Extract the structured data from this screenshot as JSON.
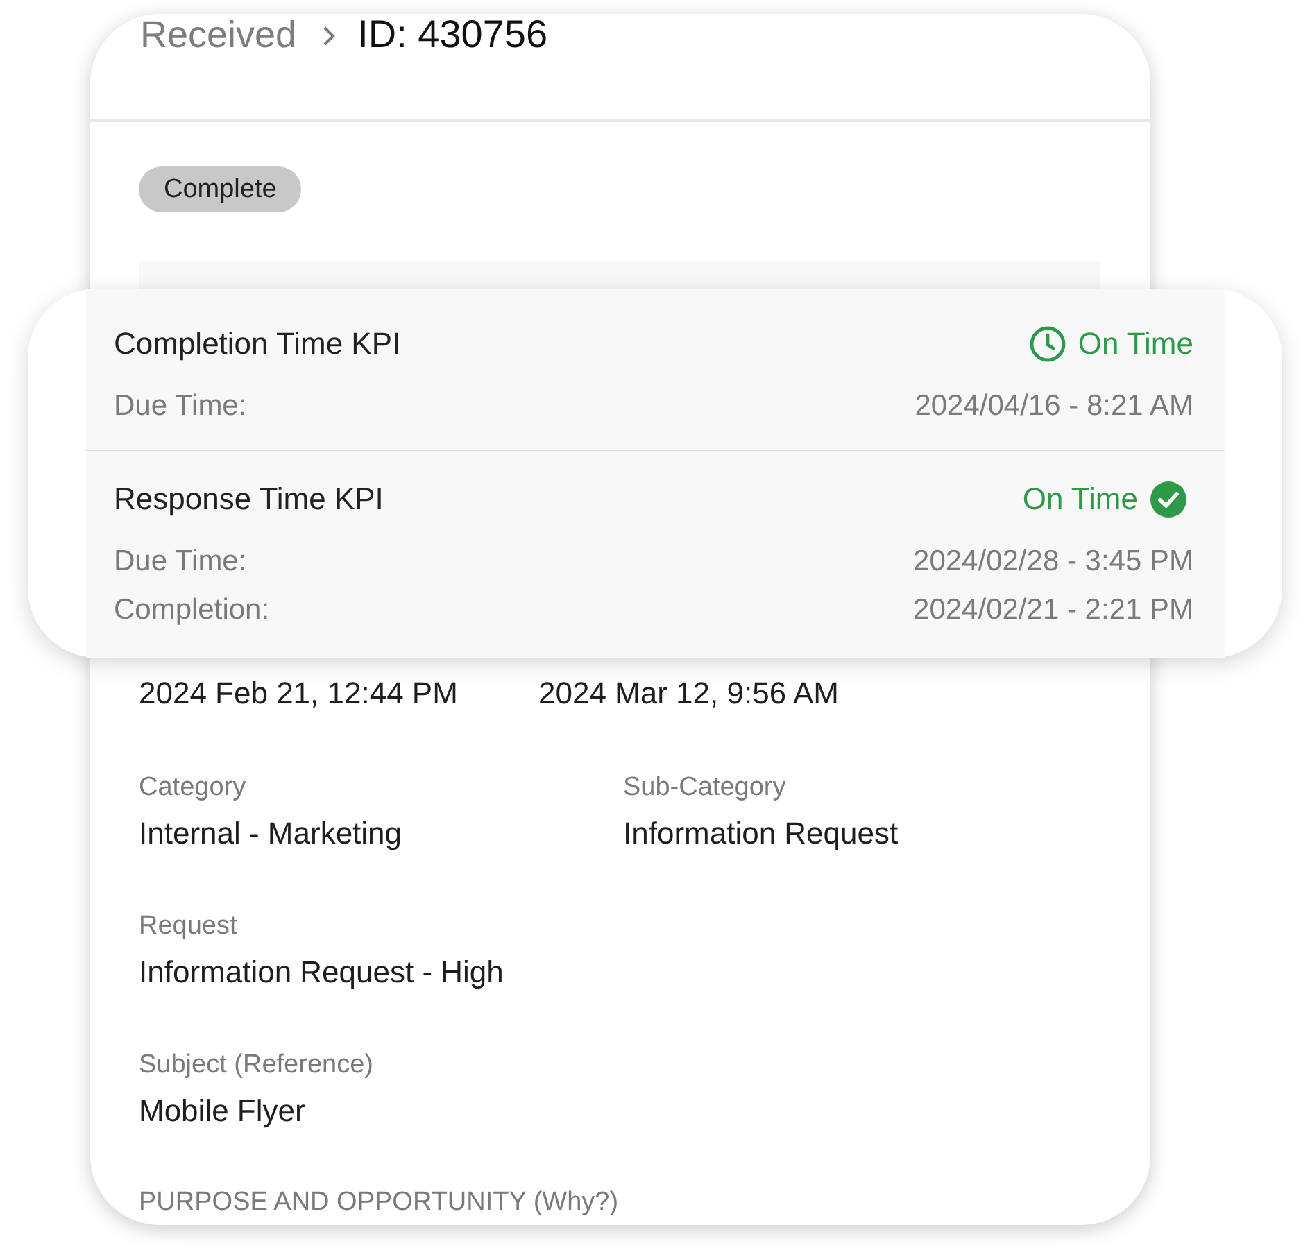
{
  "breadcrumb": {
    "parent": "Received",
    "current": "ID: 430756"
  },
  "status_badge": "Complete",
  "kpis": [
    {
      "title": "Completion Time KPI",
      "status": "On Time",
      "kind": "clock",
      "rows": [
        {
          "label": "Due Time:",
          "value": "2024/04/16 - 8:21 AM"
        }
      ]
    },
    {
      "title": "Response Time KPI",
      "status": "On Time",
      "kind": "check",
      "rows": [
        {
          "label": "Due Time:",
          "value": "2024/02/28 - 3:45 PM"
        },
        {
          "label": "Completion:",
          "value": "2024/02/21 - 2:21 PM"
        }
      ]
    }
  ],
  "dates": [
    "2024 Feb 21, 12:44 PM",
    "2024 Mar 12, 9:56 AM"
  ],
  "field_rows": [
    {
      "fields": [
        {
          "label": "Category",
          "value": "Internal - Marketing"
        },
        {
          "label": "Sub-Category",
          "value": "Information Request"
        }
      ]
    },
    {
      "fields": [
        {
          "label": "Request",
          "value": "Information Request - High"
        }
      ]
    },
    {
      "fields": [
        {
          "label": "Subject (Reference)",
          "value": "Mobile Flyer"
        }
      ]
    }
  ],
  "section_heading": "PURPOSE AND OPPORTUNITY (Why?)"
}
